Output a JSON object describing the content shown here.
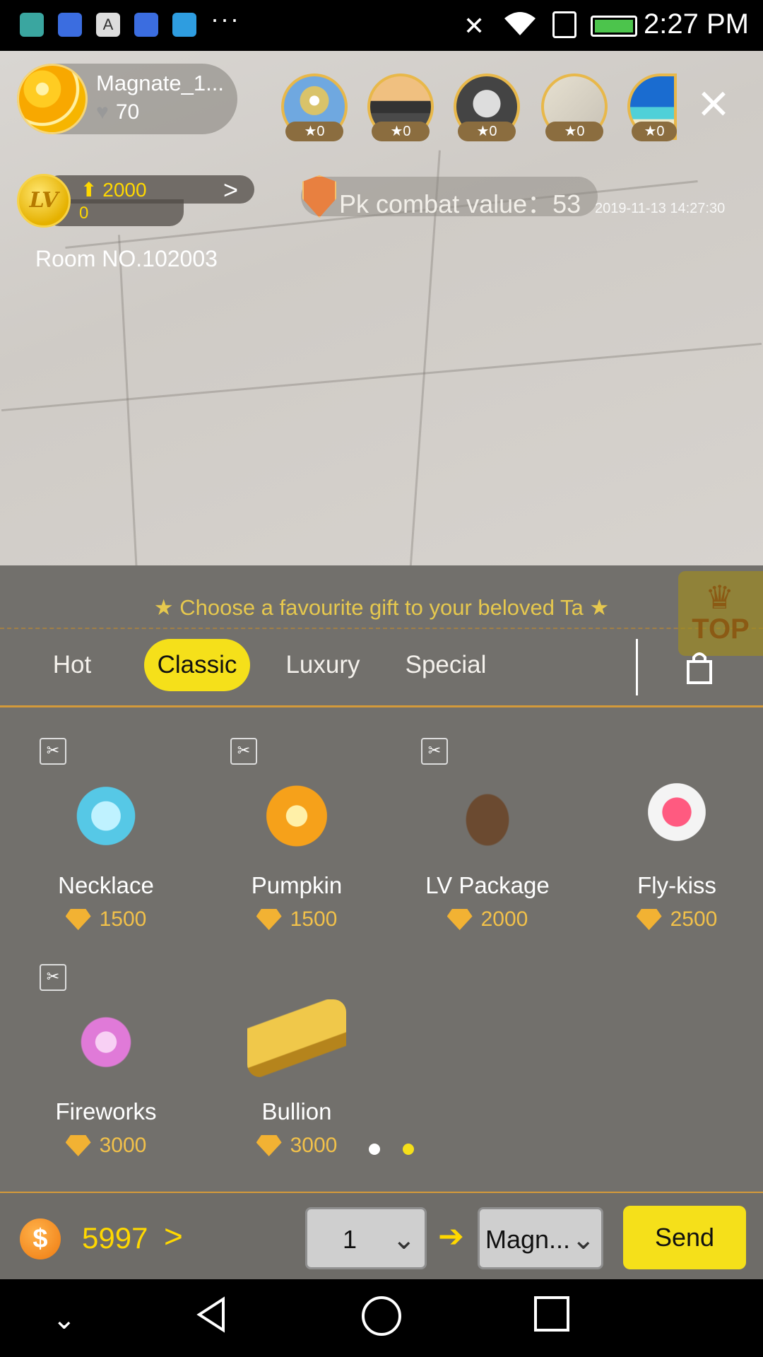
{
  "status_bar": {
    "time": "2:27 PM",
    "more": "···",
    "icons": [
      "android-icon",
      "baidu-icon",
      "font-icon",
      "baidu-icon",
      "telegram-icon",
      "mute-icon",
      "wifi-icon",
      "sim-icon",
      "battery-icon"
    ]
  },
  "host": {
    "name": "Magnate_1...",
    "likes": "70"
  },
  "viewers": [
    {
      "stars": "0"
    },
    {
      "stars": "0"
    },
    {
      "stars": "0"
    },
    {
      "stars": "0"
    },
    {
      "stars": "0"
    }
  ],
  "level": {
    "badge": "LV",
    "points": "2000",
    "current": "0"
  },
  "room": {
    "label": "Room NO.102003"
  },
  "pk": {
    "label": "Pk combat value：53"
  },
  "timestamp": "2019-11-13 14:27:30",
  "panel": {
    "title": "Choose a favourite gift to your beloved Ta",
    "top_label": "TOP"
  },
  "tabs": [
    {
      "label": "Hot",
      "active": false
    },
    {
      "label": "Classic",
      "active": true
    },
    {
      "label": "Luxury",
      "active": false
    },
    {
      "label": "Special",
      "active": false
    }
  ],
  "gifts": [
    {
      "name": "Necklace",
      "price": "1500",
      "icon": "heart-necklace-icon",
      "color": "#7ad3e8"
    },
    {
      "name": "Pumpkin",
      "price": "1500",
      "icon": "pumpkin-icon",
      "color": "#f29a1a"
    },
    {
      "name": "LV Package",
      "price": "2000",
      "icon": "handbag-icon",
      "color": "#6b4a30"
    },
    {
      "name": "Fly-kiss",
      "price": "2500",
      "icon": "winged-lips-icon",
      "color": "#ff5a80"
    },
    {
      "name": "Fireworks",
      "price": "3000",
      "icon": "fireworks-icon",
      "color": "#f08be0"
    },
    {
      "name": "Bullion",
      "price": "3000",
      "icon": "gold-bars-icon",
      "color": "#d9a62e"
    }
  ],
  "pagination": {
    "pages": 2,
    "active": 1
  },
  "bottom": {
    "balance": "5997",
    "quantity": "1",
    "receiver": "Magn...",
    "send_label": "Send"
  },
  "colors": {
    "accent_yellow": "#f5e01a",
    "gold": "#f2c14a",
    "panel_bg": "#78766f"
  }
}
